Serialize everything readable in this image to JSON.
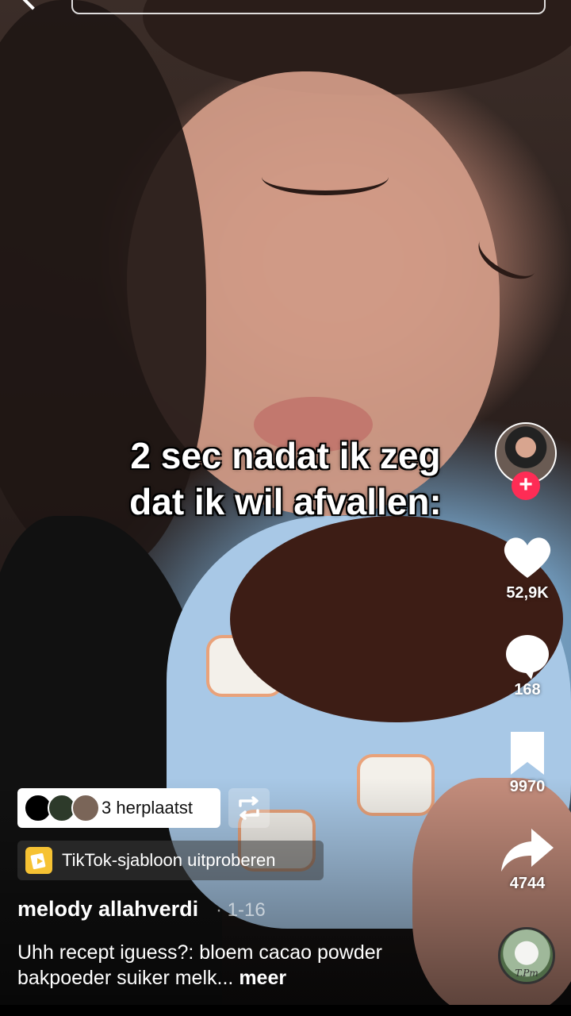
{
  "video": {
    "caption_line1": "2 sec nadat ik zeg",
    "caption_line2": "dat ik wil afvallen:"
  },
  "actions": {
    "likes": "52,9K",
    "comments": "168",
    "saves": "9970",
    "shares": "4744",
    "follow_symbol": "+"
  },
  "repost": {
    "label": "3 herplaatst"
  },
  "template": {
    "label": "TikTok-sjabloon uitproberen"
  },
  "post": {
    "author": "melody allahverdi",
    "date": "· 1-16",
    "description": "Uhh recept iguess?: bloem cacao powder  bakpoeder suiker melk...",
    "more": "meer"
  },
  "music": {
    "disc_text": "T.Pm"
  },
  "colors": {
    "accent": "#fe2c55",
    "template_icon": "#f6c233"
  }
}
